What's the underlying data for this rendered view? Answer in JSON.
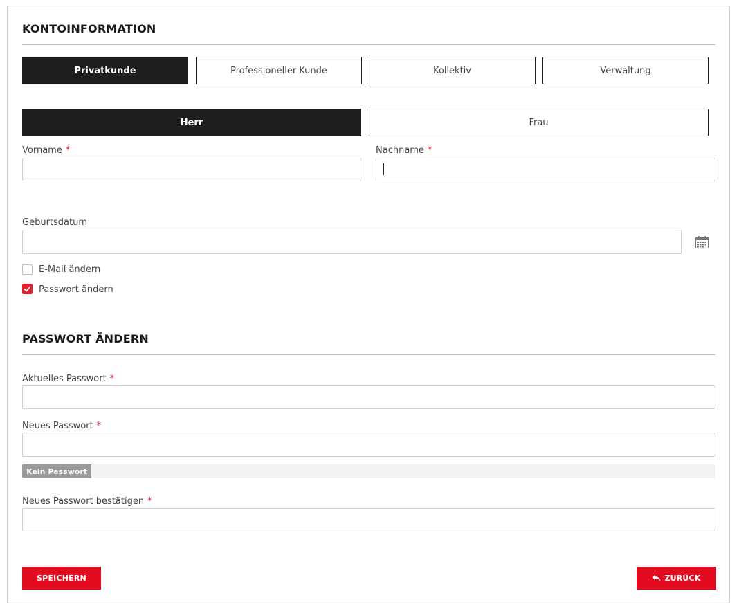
{
  "account": {
    "title": "KONTOINFORMATION",
    "customer_types": [
      {
        "label": "Privatkunde",
        "selected": true
      },
      {
        "label": "Professioneller Kunde",
        "selected": false
      },
      {
        "label": "Kollektiv",
        "selected": false
      },
      {
        "label": "Verwaltung",
        "selected": false
      }
    ],
    "salutations": [
      {
        "label": "Herr",
        "selected": true
      },
      {
        "label": "Frau",
        "selected": false
      }
    ],
    "first_name": {
      "label": "Vorname",
      "required_mark": "*",
      "value": ""
    },
    "last_name": {
      "label": "Nachname",
      "required_mark": "*",
      "value": ""
    },
    "birthdate": {
      "label": "Geburtsdatum",
      "value": "",
      "icon": "calendar-icon"
    },
    "change_email": {
      "label": "E-Mail ändern",
      "checked": false
    },
    "change_password": {
      "label": "Passwort ändern",
      "checked": true
    }
  },
  "password": {
    "title": "PASSWORT ÄNDERN",
    "current": {
      "label": "Aktuelles Passwort",
      "required_mark": "*",
      "value": ""
    },
    "new": {
      "label": "Neues Passwort",
      "required_mark": "*",
      "value": ""
    },
    "strength": {
      "label": "Kein Passwort",
      "level": 0.1
    },
    "confirm": {
      "label": "Neues Passwort bestätigen",
      "required_mark": "*",
      "value": ""
    }
  },
  "actions": {
    "save_label": "SPEICHERN",
    "back_label": "ZURÜCK",
    "back_icon": "reply-arrow-icon"
  },
  "colors": {
    "accent": "#e30b20",
    "dark": "#1e1e1e",
    "required": "#e3212f"
  }
}
